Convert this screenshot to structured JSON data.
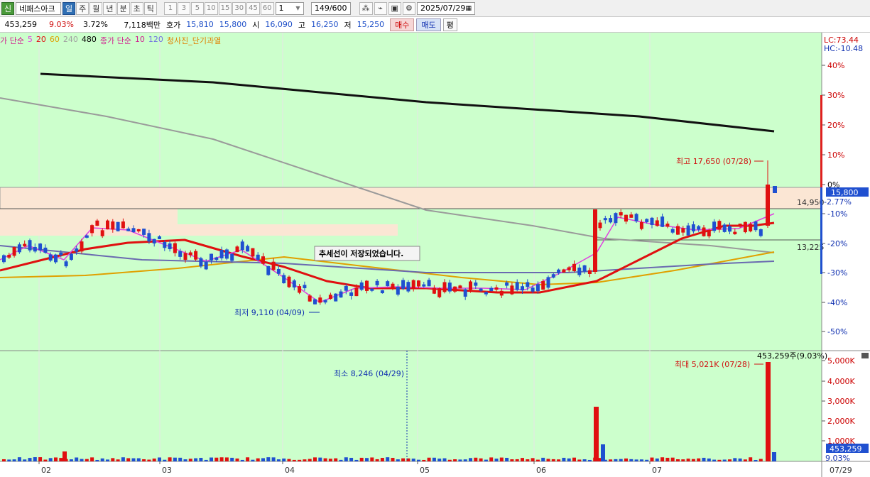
{
  "toolbar": {
    "logo": "신",
    "stock_name": "네패스아크",
    "periods": [
      "일",
      "주",
      "월",
      "년",
      "분",
      "초",
      "틱"
    ],
    "active_period": 0,
    "intervals": [
      "1",
      "3",
      "5",
      "10",
      "15",
      "30",
      "45",
      "60"
    ],
    "interval_select": "1",
    "count": "149/600",
    "date": "2025/07/29"
  },
  "quote": {
    "volume": "453,259",
    "change_pct": "9.03%",
    "turnover_pct": "3.72%",
    "amount": "7,118백만",
    "hoga_label": "호가",
    "ask": "15,810",
    "bid": "15,800",
    "open_label": "시",
    "open": "16,090",
    "high_label": "고",
    "high": "16,250",
    "low_label": "저",
    "low": "15,250",
    "buy": "매수",
    "sell": "매도",
    "eval": "평"
  },
  "legend": {
    "price_ma_label": "가 단순",
    "ma": [
      "5",
      "20",
      "60",
      "240",
      "480"
    ],
    "ma_colors": [
      "#e040e0",
      "#e01010",
      "#e0a000",
      "#a0a0a0",
      "#000000"
    ],
    "vol_ma_label": "종가 단순",
    "vol_ma": [
      "10",
      "120"
    ],
    "vol_ma_colors": [
      "#d02090",
      "#7070e0"
    ],
    "indicator": "청사진_단기과열"
  },
  "axis": {
    "lc": "LC:73.44",
    "hc": "HC:-10.48",
    "pct_ticks": [
      "40%",
      "30%",
      "20%",
      "10%",
      "0%",
      "-10%",
      "-20%",
      "-30%",
      "-40%",
      "-50%"
    ],
    "vol_ticks": [
      "5,000K",
      "4,000K",
      "3,000K",
      "2,000K",
      "1,000K"
    ],
    "current_price": "15,800",
    "current_pct": "-2.77%",
    "vol_current": "453,259",
    "vol_current_pct": "9.03%",
    "x_ticks": [
      "02",
      "03",
      "04",
      "05",
      "06",
      "07"
    ],
    "x_last": "07/29"
  },
  "annotations": {
    "high": "최고 17,650 (07/28)",
    "low": "최저 9,110 (04/09)",
    "trend_saved": "추세선이 저장되었습니다.",
    "level_upper": "14,950",
    "level_lower": "13,225",
    "vol_max": "최대 5,021K (07/28)",
    "vol_min": "최소 8,246 (04/29)",
    "vol_label": "453,259주(9.03%)"
  },
  "chart_data": {
    "type": "candlestick",
    "price_min": 9110,
    "price_max": 17650,
    "volume_max_k": 5021,
    "volume_min": 8246
  }
}
